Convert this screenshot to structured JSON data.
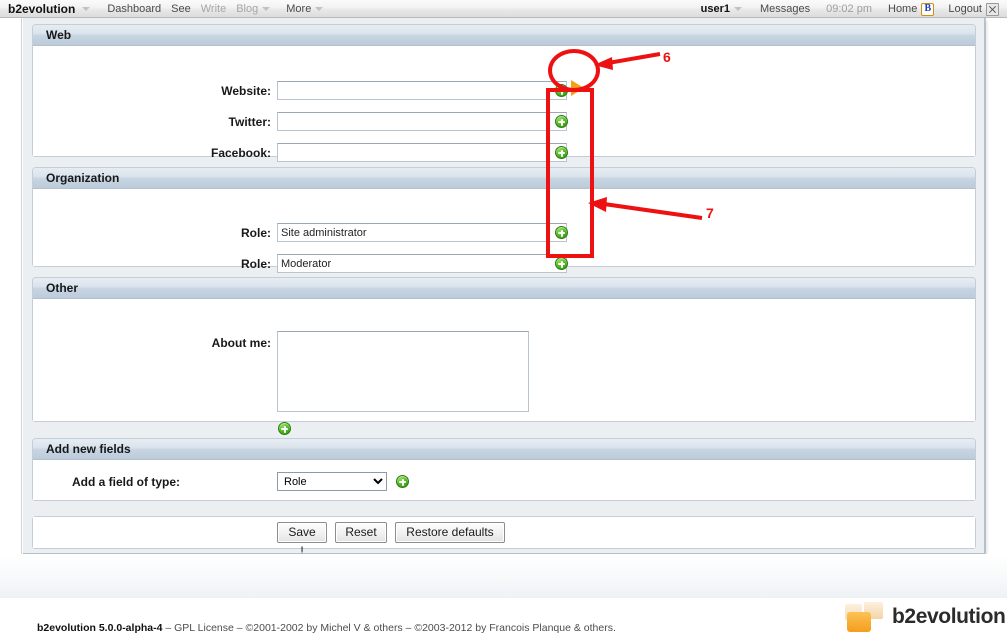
{
  "evobar": {
    "brand": "b2evolution",
    "menu": [
      {
        "label": "Dashboard",
        "dim": false,
        "caret": false
      },
      {
        "label": "See",
        "dim": false,
        "caret": false
      },
      {
        "label": "Write",
        "dim": true,
        "caret": false
      },
      {
        "label": "Blog",
        "dim": true,
        "caret": true
      },
      {
        "label": "More",
        "dim": false,
        "caret": true
      }
    ],
    "user": "user1",
    "messages": "Messages",
    "time": "09:02 pm",
    "home": "Home",
    "logout": "Logout"
  },
  "blocks": {
    "web": {
      "title": "Web",
      "fields": [
        {
          "label": "Website:",
          "value": ""
        },
        {
          "label": "Twitter:",
          "value": ""
        },
        {
          "label": "Facebook:",
          "value": ""
        }
      ]
    },
    "organization": {
      "title": "Organization",
      "fields": [
        {
          "label": "Role:",
          "value": "Site administrator"
        },
        {
          "label": "Role:",
          "value": "Moderator"
        }
      ]
    },
    "other": {
      "title": "Other",
      "fields": [
        {
          "label": "About me:",
          "value": ""
        }
      ]
    },
    "add_new_fields": {
      "title": "Add new fields",
      "label": "Add a field of type:",
      "selected": "Role",
      "options": [
        "Role"
      ]
    }
  },
  "actions": {
    "save": "Save !",
    "reset": "Reset",
    "restore": "Restore defaults"
  },
  "annotations": [
    {
      "id": "6",
      "label": "6"
    },
    {
      "id": "7",
      "label": "7"
    }
  ],
  "footer": {
    "version": "b2evolution 5.0.0-alpha-4",
    "credits": " – GPL License – ©2001-2002 by Michel V & others – ©2003-2012 by Francois Planque & others.",
    "logo_text": "b2evolution"
  },
  "colors": {
    "annotation_red": "#ee1111",
    "plus_green": "#4db31f",
    "play_orange": "#f5a01b",
    "header_blue": "#bccbdb"
  }
}
